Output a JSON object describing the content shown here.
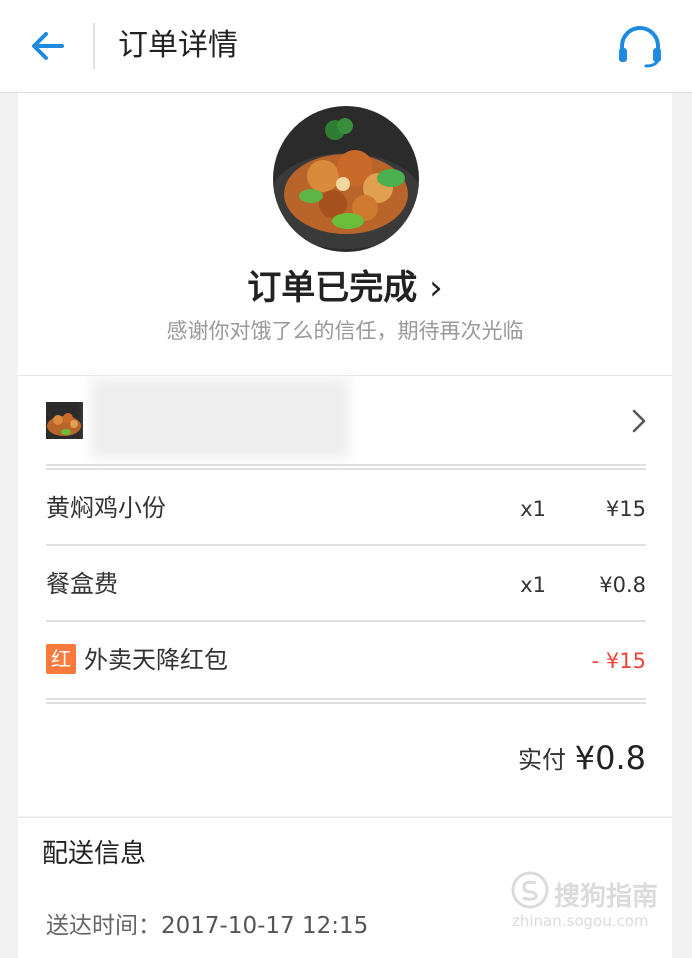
{
  "header": {
    "title": "订单详情",
    "back_icon": "arrow-left-icon",
    "service_icon": "headset-icon",
    "accent_color": "#1e8be0"
  },
  "status": {
    "title": "订单已完成",
    "chevron": "›",
    "subtitle": "感谢你对饿了么的信任，期待再次光临"
  },
  "shop": {
    "name": "",
    "chevron_icon": "chevron-right-icon"
  },
  "items": [
    {
      "name": "黄焖鸡小份",
      "qty": "x1",
      "price": "¥15"
    },
    {
      "name": "餐盒费",
      "qty": "x1",
      "price": "¥0.8"
    }
  ],
  "discount": {
    "badge": "红",
    "name": "外卖天降红包",
    "price": "- ¥15",
    "color": "#f2453a"
  },
  "total": {
    "label": "实付",
    "value": "¥0.8"
  },
  "delivery": {
    "title": "配送信息",
    "time_label": "送达时间：",
    "time_value": "2017-10-17 12:15"
  },
  "watermark": {
    "text": "搜狗指南",
    "url": "zhinan.sogou.com"
  }
}
